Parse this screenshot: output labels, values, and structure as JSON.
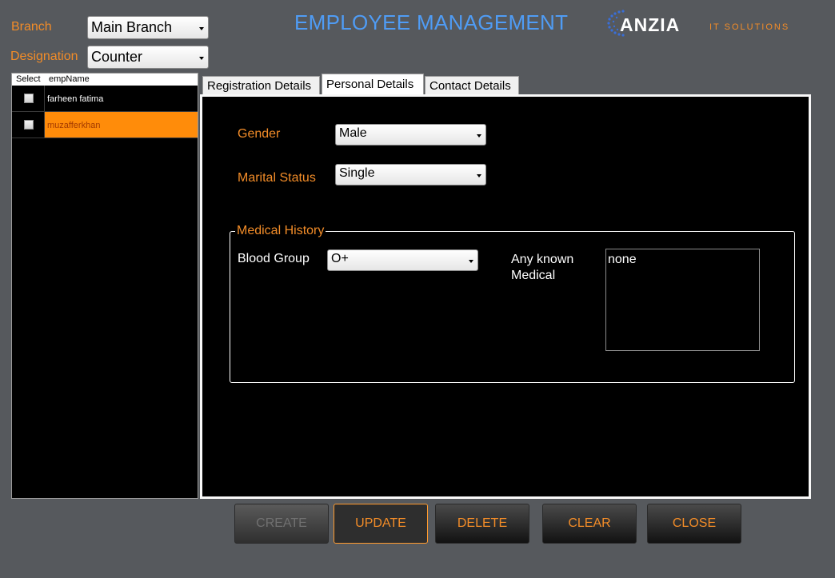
{
  "filters": {
    "branch_label": "Branch",
    "branch_value": "Main Branch",
    "designation_label": "Designation",
    "designation_value": "Counter"
  },
  "app_title": "EMPLOYEE MANAGEMENT",
  "logo": {
    "brand": "ANZIA",
    "tagline": "IT SOLUTIONS"
  },
  "grid": {
    "columns": [
      "Select",
      "empName"
    ],
    "rows": [
      {
        "name": "farheen fatima",
        "checked": false,
        "selected": false
      },
      {
        "name": "muzafferkhan",
        "checked": false,
        "selected": true
      }
    ]
  },
  "tabs": [
    {
      "label": "Registration Details",
      "active": false
    },
    {
      "label": "Personal Details",
      "active": true
    },
    {
      "label": "Contact Details",
      "active": false
    }
  ],
  "personal": {
    "gender_label": "Gender",
    "gender_value": "Male",
    "marital_label": "Marital Status",
    "marital_value": "Single",
    "medical_history_legend": "Medical History",
    "blood_group_label": "Blood Group",
    "blood_group_value": "O+",
    "known_medical_label_line1": "Any known",
    "known_medical_label_line2": "Medical",
    "known_medical_value": "none"
  },
  "buttons": {
    "create": "CREATE",
    "update": "UPDATE",
    "delete": "DELETE",
    "clear": "CLEAR",
    "close": "CLOSE"
  },
  "colors": {
    "accent_orange": "#f28c28",
    "title_blue": "#4f9cf5",
    "background": "#56595d",
    "selected_row": "#ff8c0a"
  }
}
